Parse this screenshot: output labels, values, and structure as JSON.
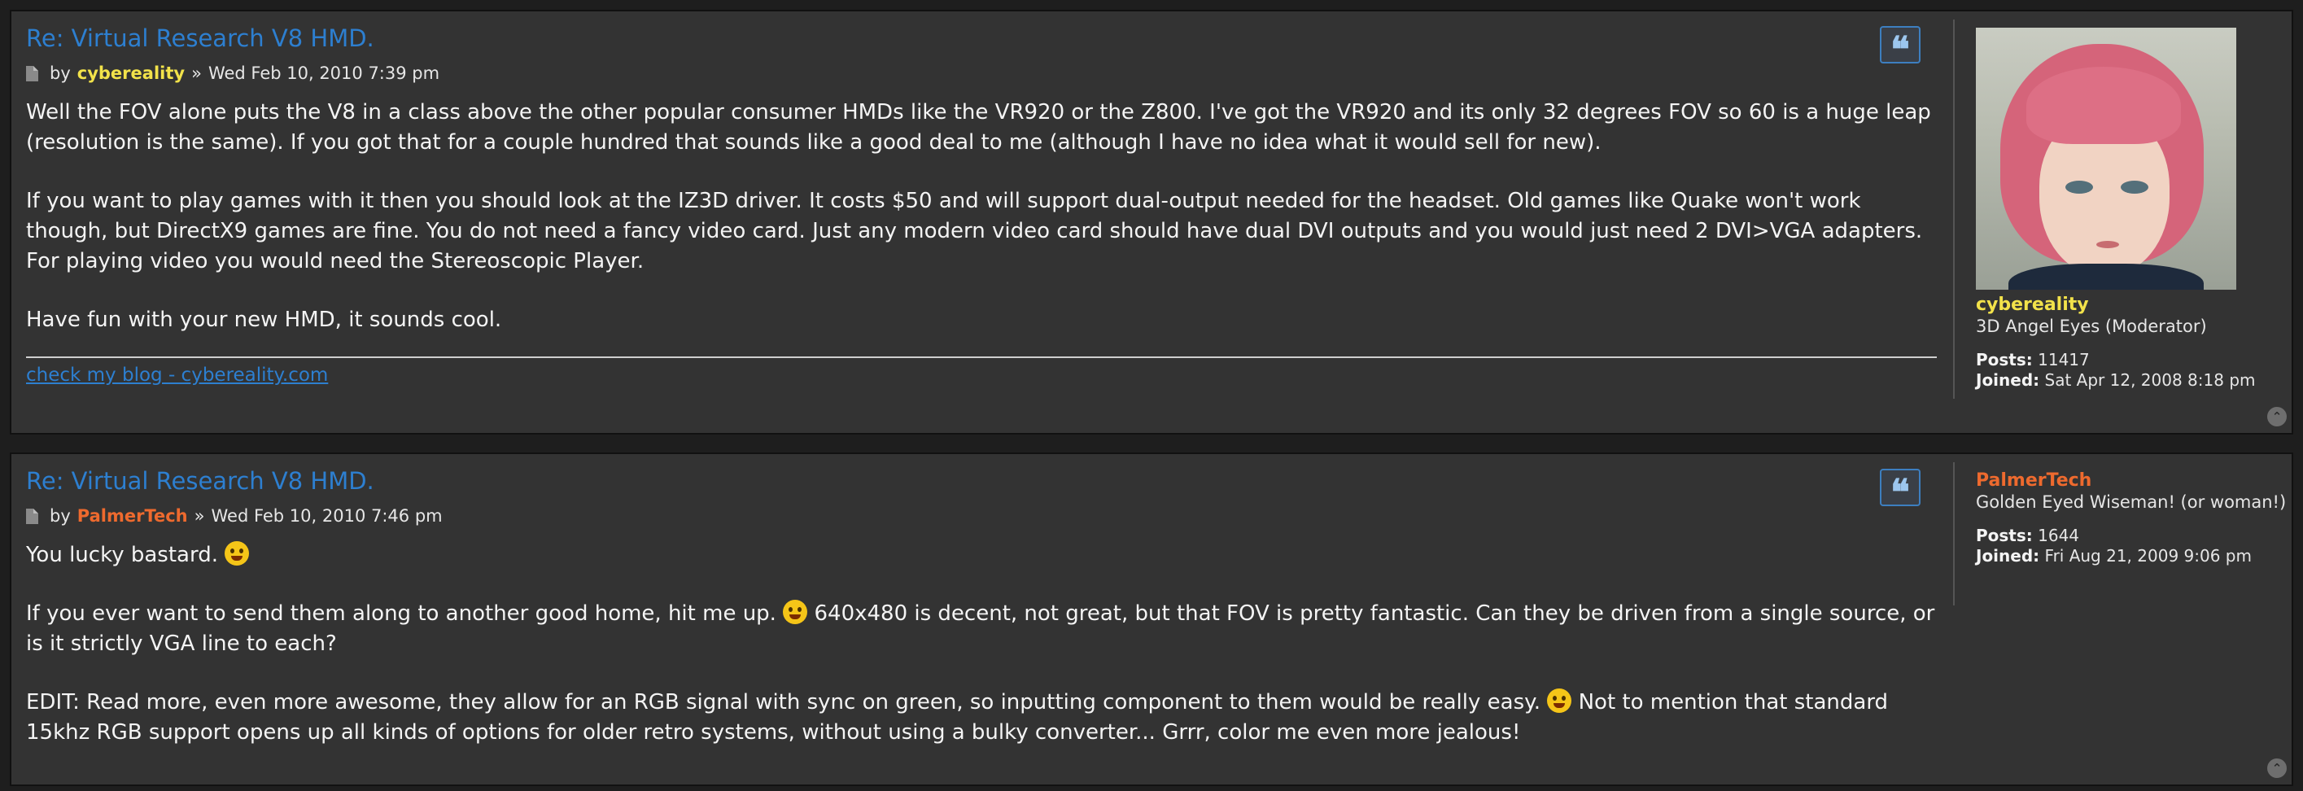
{
  "posts": [
    {
      "title": "Re: Virtual Research V8 HMD.",
      "by_label": "by",
      "author": "cybereality",
      "author_color": "#f2e24a",
      "separator": "»",
      "date": "Wed Feb 10, 2010 7:39 pm",
      "paragraphs": [
        "Well the FOV alone puts the V8 in a class above the other popular consumer HMDs like the VR920 or the Z800. I've got the VR920 and its only 32 degrees FOV so 60 is a huge leap (resolution is the same). If you got that for a couple hundred that sounds like a good deal to me (although I have no idea what it would sell for new).",
        "If you want to play games with it then you should look at the IZ3D driver. It costs $50 and will support dual-output needed for the headset. Old games like Quake won't work though, but DirectX9 games are fine. You do not need a fancy video card. Just any modern video card should have dual DVI outputs and you would just need 2 DVI>VGA adapters. For playing video you would need the Stereoscopic Player.",
        "Have fun with your new HMD, it sounds cool."
      ],
      "signature_link": "check my blog - cybereality.com",
      "quote_icon": "quote-icon",
      "profile": {
        "name": "cybereality",
        "rank": "3D Angel Eyes (Moderator)",
        "posts_label": "Posts:",
        "posts": "11417",
        "joined_label": "Joined:",
        "joined": "Sat Apr 12, 2008 8:18 pm"
      }
    },
    {
      "title": "Re: Virtual Research V8 HMD.",
      "by_label": "by",
      "author": "PalmerTech",
      "author_color": "#ee6a2e",
      "separator": "»",
      "date": "Wed Feb 10, 2010 7:46 pm",
      "p1": "You lucky bastard.",
      "p2a": "If you ever want to send them along to another good home, hit me up.",
      "p2b": "640x480 is decent, not great, but that FOV is pretty fantastic. Can they be driven from a single source, or is it strictly VGA line to each?",
      "p3a": "EDIT: Read more, even more awesome, they allow for an RGB signal with sync on green, so inputting component to them would be really easy.",
      "p3b": "Not to mention that standard 15khz RGB support opens up all kinds of options for older retro systems, without using a bulky converter... Grrr, color me even more jealous!",
      "quote_icon": "quote-icon",
      "profile": {
        "name": "PalmerTech",
        "rank": "Golden Eyed Wiseman! (or woman!)",
        "posts_label": "Posts:",
        "posts": "1644",
        "joined_label": "Joined:",
        "joined": "Fri Aug 21, 2009 9:06 pm"
      }
    }
  ],
  "icons": {
    "post": "post-icon",
    "back_to_top": "back-to-top-icon",
    "quote_glyph": "❝",
    "top_glyph": "⌃"
  }
}
